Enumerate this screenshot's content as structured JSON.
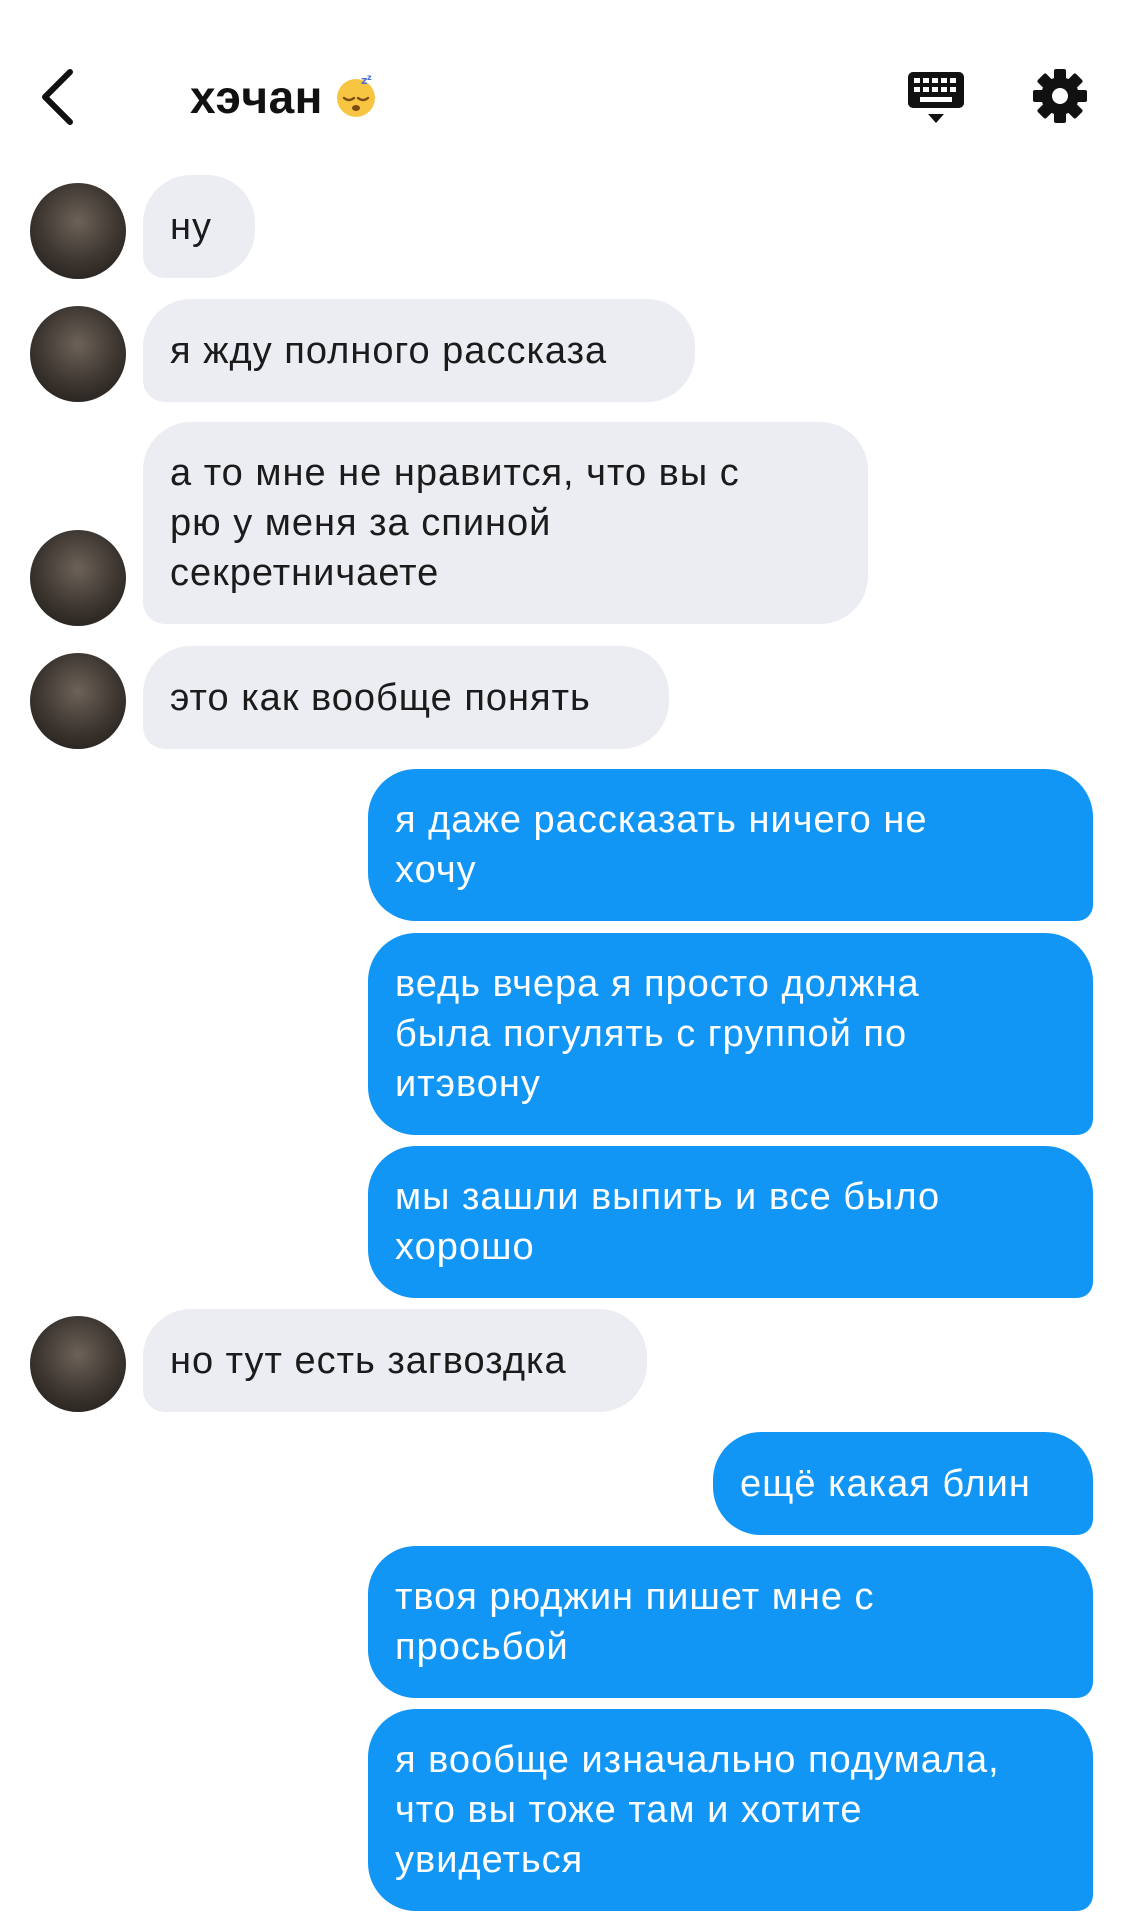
{
  "header": {
    "title": "хэчан",
    "title_emoji": "sleeping-face-emoji",
    "back_icon": "chevron-left-icon",
    "keyboard_icon": "keyboard-icon",
    "settings_icon": "gear-icon"
  },
  "colors": {
    "incoming_bubble": "#ebedf2",
    "outgoing_bubble": "#1296f6",
    "incoming_text": "#1b1b1b",
    "outgoing_text": "#ffffff"
  },
  "messages": [
    {
      "side": "in",
      "text": "ну"
    },
    {
      "side": "in",
      "text": "я жду полного рассказа"
    },
    {
      "side": "in",
      "text": "а то мне не нравится, что вы с\nрю у меня за спиной\nсекретничаете"
    },
    {
      "side": "in",
      "text": "это как вообще понять"
    },
    {
      "side": "out",
      "text": "я даже рассказать ничего не\nхочу"
    },
    {
      "side": "out",
      "text": "ведь вчера я просто должна\nбыла погулять с группой по\nитэвону"
    },
    {
      "side": "out",
      "text": "мы зашли выпить и все было\nхорошо"
    },
    {
      "side": "in",
      "text": "но тут есть загвоздка"
    },
    {
      "side": "out",
      "text": "ещё какая блин"
    },
    {
      "side": "out",
      "text": "твоя рюджин пишет мне с\nпросьбой"
    },
    {
      "side": "out",
      "text": "я вообще изначально подумала,\nчто вы тоже там и хотите\nувидеться"
    }
  ]
}
